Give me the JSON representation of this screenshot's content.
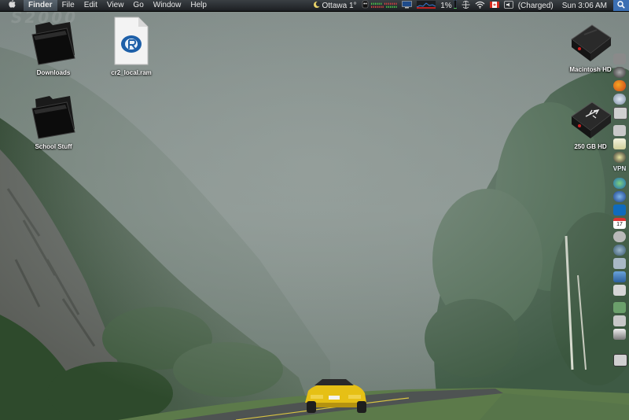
{
  "menubar": {
    "apple_icon": "apple-logo-icon",
    "app_name": "Finder",
    "menus": [
      "File",
      "Edit",
      "View",
      "Go",
      "Window",
      "Help"
    ],
    "weather": "Ottawa 1°",
    "cpu_percent": "1%",
    "battery_status": "(Charged)",
    "clock": "Sun 3:06 AM",
    "colors": {
      "bar": "#2a2e32",
      "highlight": "#4a5560"
    }
  },
  "desktop": {
    "watermark": "S2000",
    "icons": [
      {
        "label": "Downloads"
      },
      {
        "label": "cr2_local.ram"
      },
      {
        "label": "School Stuff"
      },
      {
        "label": "Macintosh HD"
      },
      {
        "label": "250 GB HD"
      }
    ]
  },
  "dock": {
    "vpn_label": "VPN",
    "calendar_day": "17",
    "items": [
      "app-icon",
      "app-icon",
      "firefox-icon",
      "safari-icon",
      "preview-icon",
      "mail-icon",
      "textedit-icon",
      "itunes-icon",
      "vpn-icon",
      "network-icon",
      "browser-icon",
      "app-icon",
      "ical-icon",
      "app-icon",
      "app-icon",
      "app-icon",
      "iphoto-icon",
      "document-icon",
      "app-icon",
      "app-icon",
      "itunes-icon",
      "trash-icon"
    ]
  }
}
